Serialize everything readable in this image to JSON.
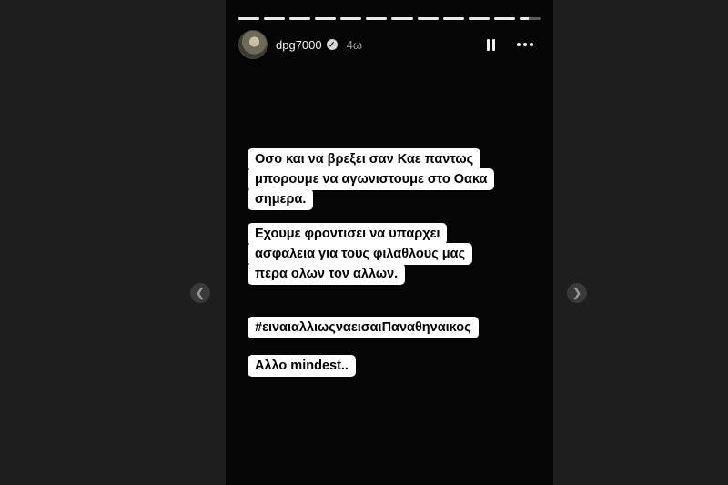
{
  "progress": {
    "segments": 12,
    "completed": 11,
    "current_fraction": 0.45
  },
  "header": {
    "username": "dpg7000",
    "verified_icon": "verified-badge-icon",
    "time": "4ω",
    "pause_icon": "pause-icon",
    "more_icon": "more-options-icon"
  },
  "story": {
    "blocks": [
      {
        "lines": [
          "Οσο και να βρεξει σαν Καε παντως",
          "μπορουμε να αγωνιστουμε στο Οακα",
          "σημερα."
        ]
      },
      {
        "lines": [
          "Εχουμε φροντισει να υπαρχει",
          "ασφαλεια για τους φιλαθλους μας",
          "περα ολων τον αλλων."
        ]
      },
      {
        "lines": [
          "#ειναιαλλιωςναεισαιΠαναθηναικος"
        ]
      },
      {
        "lines": [
          "Αλλο mindest.."
        ]
      }
    ]
  },
  "navigation": {
    "prev_icon": "chevron-left-icon",
    "next_icon": "chevron-right-icon"
  }
}
